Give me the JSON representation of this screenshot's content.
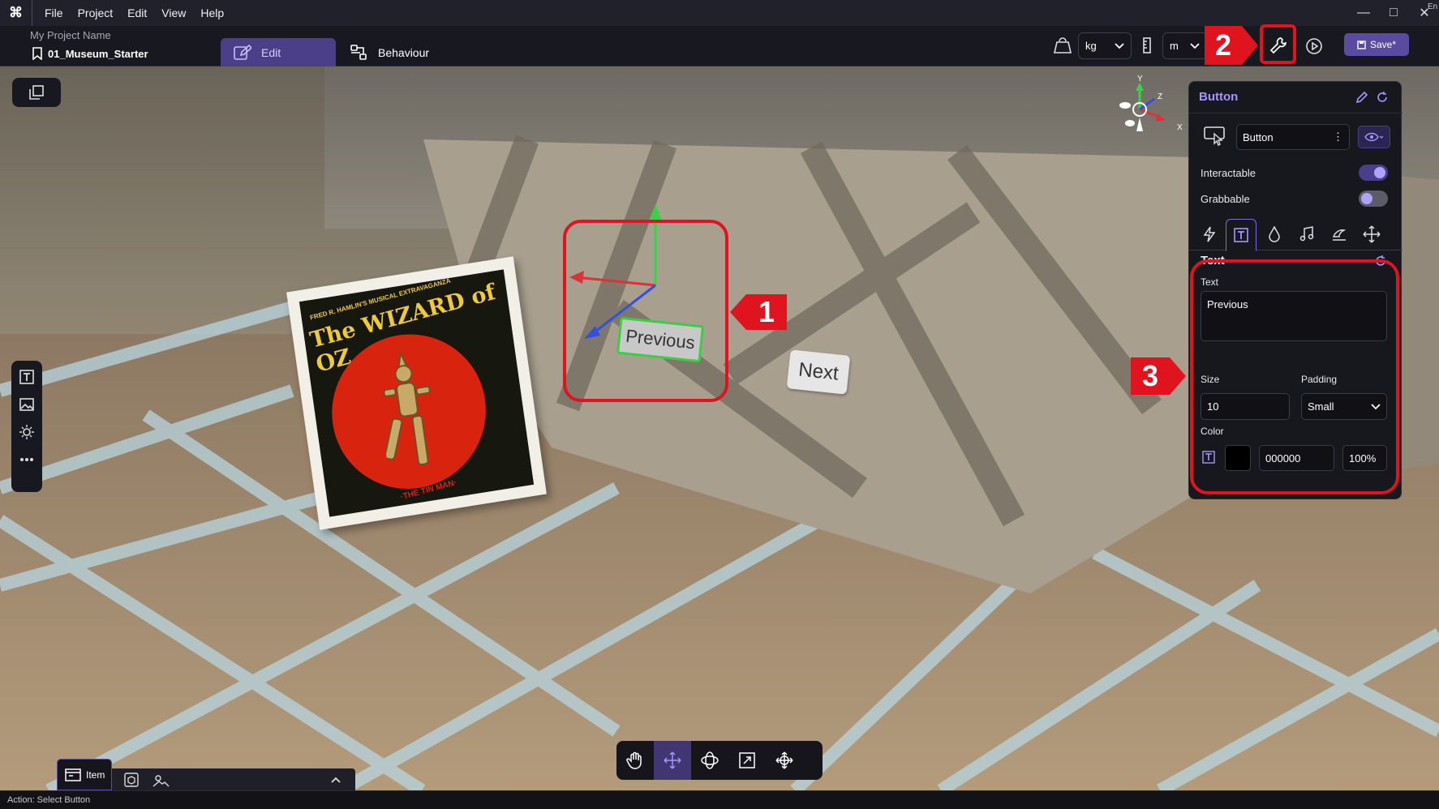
{
  "app": {
    "logo": "⌘",
    "menu": [
      "File",
      "Project",
      "Edit",
      "View",
      "Help"
    ],
    "window_controls": {
      "minimize": "—",
      "maximize": "□",
      "close": "✕"
    },
    "corner_text": "En"
  },
  "toolbar": {
    "project_name": "My Project Name",
    "scene_name": "01_Museum_Starter",
    "tabs": [
      {
        "label": "Edit",
        "icon": "edit-icon",
        "active": true
      },
      {
        "label": "Behaviour",
        "icon": "flow-icon",
        "active": false
      }
    ],
    "mass_unit": "kg",
    "length_unit": "m",
    "save_label": "Save*",
    "accent_color": "#5a4ba0"
  },
  "viewport": {
    "button_previous_label": "Previous",
    "button_next_label": "Next",
    "poster": {
      "top_text": "FRED R. HAMLIN'S MUSICAL EXTRAVAGANZA",
      "title": "The WIZARD of OZ",
      "bottom_text": "·THE TIN MAN·"
    },
    "gizmo": {
      "y": "Y",
      "z": "Z",
      "x": "X"
    }
  },
  "annotations": [
    {
      "number": "1",
      "color": "#e0141e"
    },
    {
      "number": "2",
      "color": "#e0141e"
    },
    {
      "number": "3",
      "color": "#e0141e"
    }
  ],
  "inspector": {
    "title": "Button",
    "name_value": "Button",
    "interactable_label": "Interactable",
    "interactable_on": true,
    "grabbable_label": "Grabbable",
    "grabbable_on": false,
    "tabs": [
      "lightning-icon",
      "text-icon",
      "droplet-icon",
      "music-icon",
      "stamp-icon",
      "move-icon"
    ],
    "active_tab": "text-icon",
    "text_section": {
      "heading": "Text",
      "text_label": "Text",
      "text_value": "Previous",
      "size_label": "Size",
      "size_value": "10",
      "padding_label": "Padding",
      "padding_value": "Small",
      "color_label": "Color",
      "color_hex": "000000",
      "opacity": "100%",
      "swatch_color": "#000000"
    }
  },
  "bottom": {
    "item_tab_label": "Item",
    "status": "Action: Select Button"
  }
}
